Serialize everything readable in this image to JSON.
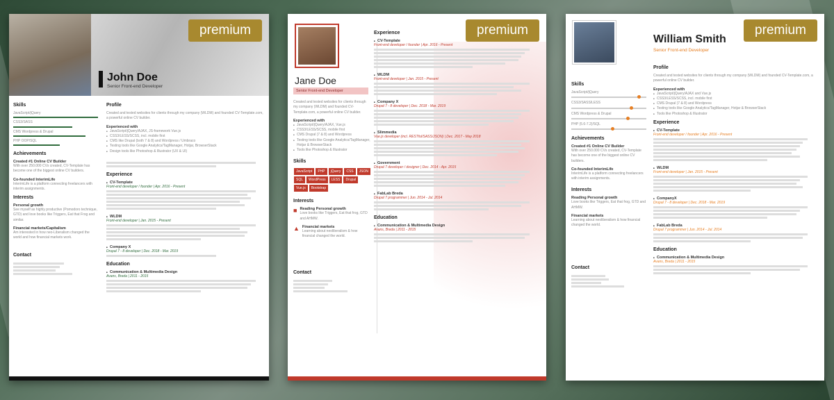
{
  "badge": "premium",
  "card1": {
    "name": "John Doe",
    "role": "Senior Front-end Developer",
    "skills_title": "Skills",
    "skills": [
      "JavaScript/jQuery",
      "CSS3/SASS",
      "CMS Wordpress & Drupal",
      "PHP OOP/SQL"
    ],
    "achievements_title": "Achievements",
    "ach1_title": "Created #1 Online CV Builder",
    "ach1_text": "With over 250.000 CVs created, CV-Template has become one of the biggest online CV builders.",
    "ach2_title": "Co-founded InterimLife",
    "ach2_text": "InterimLife is a platform connecting freelancers with interim assignments.",
    "interests_title": "Interests",
    "int1_title": "Personal growth",
    "int1_text": "See myself as highly productive (Pomodoro technique, GTD) and love books like Triggers, Eat that Frog and similar.",
    "int2_title": "Financial markets/Capitalism",
    "int2_text": "Am interested in how neo-Liberalism changed the world and how financial markets work.",
    "contact_title": "Contact",
    "profile_title": "Profile",
    "profile_text": "Created and tested websites for clients through my company (WLDM) and founded CV-Template.com, a powerful online CV builder.",
    "experienced_title": "Experienced with",
    "experienced": [
      "JavaScript/jQuery/AJAX, JS-framework Vue.js",
      "CSS3/LESS/SCSS, incl. mobile first",
      "CMS like Drupal (both 7 & 8) and Wordpress / Umbraco",
      "Testing tools like Google Analytics/TagManager, Hotjar, BrowserStack",
      "Design tools like Photoshop & Illustrator (UX & UI)"
    ],
    "experience_title": "Experience",
    "jobs": [
      {
        "company": "CV-Template",
        "meta": "Front-end developer / founder | Apr. 2016 - Present"
      },
      {
        "company": "WLDM",
        "meta": "Front-end developer | Jan. 2015 - Present"
      },
      {
        "company": "Company X",
        "meta": "Drupal 7 - 8 developer | Dec. 2018 - Mar. 2019"
      }
    ],
    "education_title": "Education",
    "edu_title": "Communication & Multimedia Design",
    "edu_meta": "Avans, Breda | 2011 - 2015"
  },
  "card2": {
    "name": "Jane Doe",
    "role": "Senior Front-end Developer",
    "profile_text": "Created and tested websites for clients through my company (WLDM) and founded CV-Template.com, a powerful online CV builder.",
    "experienced_title": "Experienced with",
    "experienced": [
      "JavaScript/jQuery/AJAX, Vue.js",
      "CSS3/LESS/SCSS, mobile first",
      "CMS Drupal (7 & 8) and Wordpress",
      "Testing tools like Google Analytics/TagManager, Hotjar & BrowserStack",
      "Tools like Photoshop & Illustrator"
    ],
    "skills_title": "Skills",
    "tags": [
      "JavaScript",
      "PHP",
      "jQuery",
      "CSS",
      "JSON",
      "SQL",
      "WordPress",
      "LESS",
      "Drupal",
      "Vue.js",
      "Bootstrap"
    ],
    "interests_title": "Interests",
    "int1_title": "Reading Personal growth",
    "int1_text": "Love books like Triggers, Eat that frog, GTD and AHMW.",
    "int2_title": "Financial markets",
    "int2_text": "Learning about neoliberalism & how financial changed the world.",
    "contact_title": "Contact",
    "experience_title": "Experience",
    "jobs": [
      {
        "company": "CV-Template",
        "meta": "Front-end developer / founder | Apr. 2016 - Present"
      },
      {
        "company": "WLDM",
        "meta": "Front-end developer | Jan. 2015 - Present"
      },
      {
        "company": "Company X",
        "meta": "Drupal 7 - 8 developer | Dec. 2018 - Mar. 2019"
      },
      {
        "company": "Slimmedia",
        "meta": "Vue.js developer (incl. RESTful/SASS/JSON) | Dec. 2017 - May 2018"
      },
      {
        "company": "Government",
        "meta": "Drupal 7 developer / designer | Dec. 2014 - Apr. 2015"
      },
      {
        "company": "FabLab Breda",
        "meta": "Drupal 7 programmer | Jun. 2014 - Jul. 2014"
      }
    ],
    "education_title": "Education",
    "edu_title": "Communication & Multimedia Design",
    "edu_meta": "Avans, Breda | 2011 - 2015"
  },
  "card3": {
    "name": "William Smith",
    "role": "Senior Front-end Developer",
    "skills_title": "Skills",
    "skills": [
      {
        "label": "JavaScript/jQuery",
        "level": 0.9
      },
      {
        "label": "CSS3/SASS/LESS",
        "level": 0.8
      },
      {
        "label": "CMS Wordpress & Drupal",
        "level": 0.75
      },
      {
        "label": "PHP (5.6-7.2)/SQL",
        "level": 0.55
      }
    ],
    "achievements_title": "Achievements",
    "ach1_title": "Created #1 Online CV Builder",
    "ach1_text": "With over 250.000 CVs created, CV-Template has become one of the biggest online CV builders.",
    "ach2_title": "Co-founded InterimLife",
    "ach2_text": "InterimLife is a platform connecting freelancers with interim assignments.",
    "interests_title": "Interests",
    "int1_title": "Reading Personal growth",
    "int1_text": "Love books like Triggers, Eat that frog, GTD and AHMW.",
    "int2_title": "Financial markets",
    "int2_text": "Learning about neoliberalism & how financial changed the world.",
    "contact_title": "Contact",
    "profile_title": "Profile",
    "profile_text": "Created and tested websites for clients through my company (WLDM) and founded CV-Template.com, a powerful online CV builder.",
    "experienced_title": "Experienced with",
    "experienced": [
      "JavaScript/jQuery/AJAX and Vue.js",
      "CSS3/LESS/SCSS, incl. mobile first",
      "CMS Drupal (7 & 8) and Wordpress",
      "Testing tools like Google Analytics/TagManager, Hotjar & BrowserStack",
      "Tools like Photoshop & Illustrator"
    ],
    "experience_title": "Experience",
    "jobs": [
      {
        "company": "CV-Template",
        "meta": "Front-end developer / founder | Apr. 2016 - Present"
      },
      {
        "company": "WLDM",
        "meta": "Front-end developer | Jan. 2015 - Present"
      },
      {
        "company": "CompanyX",
        "meta": "Drupal 7 - 8 developer | Dec. 2018 - Mar. 2019"
      },
      {
        "company": "FabLab Breda",
        "meta": "Drupal 7 programmer | Jun. 2014 - Jul. 2014"
      }
    ],
    "education_title": "Education",
    "edu_title": "Communication & Multimedia Design",
    "edu_meta": "Avans, Breda | 2011 - 2015"
  }
}
